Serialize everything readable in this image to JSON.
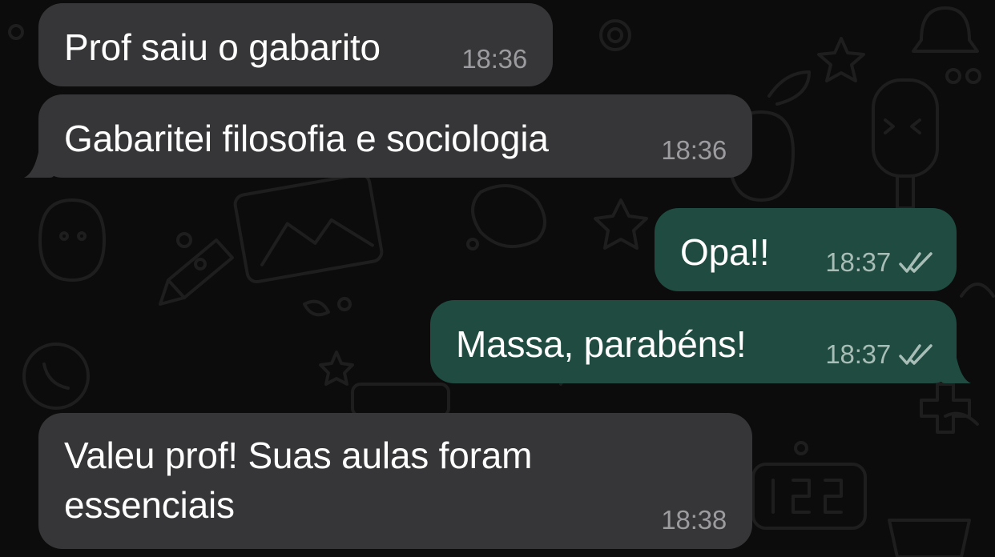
{
  "messages": [
    {
      "direction": "incoming",
      "text": "Prof saiu o gabarito",
      "time": "18:36"
    },
    {
      "direction": "incoming",
      "text": "Gabaritei filosofia e sociologia",
      "time": "18:36"
    },
    {
      "direction": "outgoing",
      "text": "Opa!!",
      "time": "18:37",
      "status_icon": "double-check-icon"
    },
    {
      "direction": "outgoing",
      "text": "Massa, parabéns!",
      "time": "18:37",
      "status_icon": "double-check-icon"
    },
    {
      "direction": "incoming",
      "text_lines": [
        "Valeu prof! Suas aulas foram",
        "essenciais"
      ],
      "time": "18:38"
    }
  ],
  "colors": {
    "background": "#0c0c0c",
    "incoming_bubble": "#363638",
    "outgoing_bubble": "#1f4b40",
    "incoming_timestamp": "#9c9ca0",
    "outgoing_timestamp": "#a7bdb6"
  }
}
